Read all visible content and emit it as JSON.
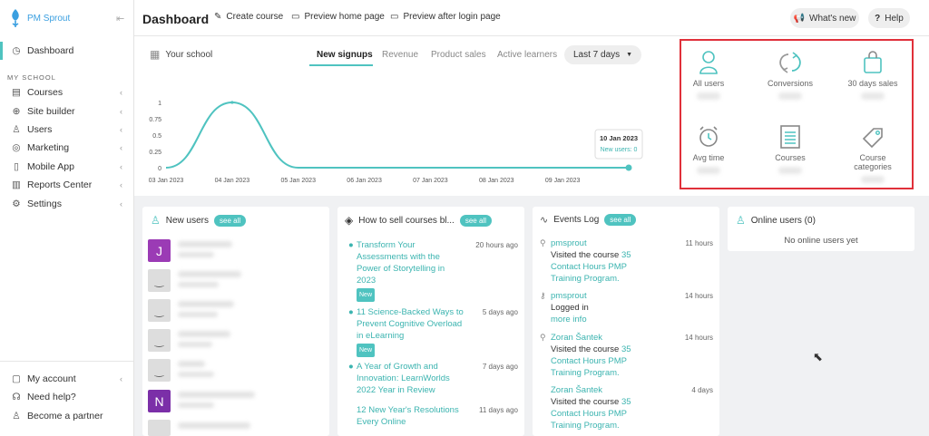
{
  "app": {
    "name": "PM Sprout"
  },
  "sidebar": {
    "dashboard": "Dashboard",
    "section_title": "MY SCHOOL",
    "items": [
      {
        "label": "Courses",
        "icon": "courses-icon"
      },
      {
        "label": "Site builder",
        "icon": "globe-icon"
      },
      {
        "label": "Users",
        "icon": "user-icon"
      },
      {
        "label": "Marketing",
        "icon": "marketing-icon"
      },
      {
        "label": "Mobile App",
        "icon": "mobile-icon"
      },
      {
        "label": "Reports Center",
        "icon": "reports-icon"
      },
      {
        "label": "Settings",
        "icon": "gear-icon"
      }
    ],
    "bottom": [
      {
        "label": "My account",
        "icon": "account-icon"
      },
      {
        "label": "Need help?",
        "icon": "headset-icon"
      },
      {
        "label": "Become a partner",
        "icon": "partner-icon"
      }
    ]
  },
  "header": {
    "title": "Dashboard",
    "links": [
      "Create course",
      "Preview home page",
      "Preview after login page"
    ],
    "whats_new": "What's new",
    "help": "Help"
  },
  "school": {
    "title": "Your school",
    "tabs": [
      "New signups",
      "Revenue",
      "Product sales",
      "Active learners"
    ],
    "active_tab": "New signups",
    "range": "Last 7 days"
  },
  "chart_data": {
    "type": "line",
    "x": [
      "03 Jan 2023",
      "04 Jan 2023",
      "05 Jan 2023",
      "06 Jan 2023",
      "07 Jan 2023",
      "08 Jan 2023",
      "09 Jan 2023",
      "10 Jan 2023"
    ],
    "series": [
      {
        "values": [
          0,
          1,
          0,
          0,
          0,
          0,
          0,
          0
        ]
      }
    ],
    "y_ticks": [
      "0",
      "0.25",
      "0.5",
      "0.75",
      "1"
    ],
    "ylim": [
      0,
      1
    ],
    "tooltip": {
      "date": "10 Jan 2023",
      "text": "New users: 0"
    },
    "color": "#4fc3c0"
  },
  "stats": [
    {
      "label": "All users",
      "icon": "user-outline-icon"
    },
    {
      "label": "Conversions",
      "icon": "conversions-icon"
    },
    {
      "label": "30 days sales",
      "icon": "shopping-bag-icon"
    },
    {
      "label": "Avg time",
      "icon": "alarm-clock-icon"
    },
    {
      "label": "Courses",
      "icon": "courses-list-icon"
    },
    {
      "label": "Course categories",
      "icon": "tag-icon"
    }
  ],
  "new_users": {
    "title": "New users",
    "see_all": "see all",
    "initials": [
      "J",
      "N"
    ]
  },
  "blog": {
    "title": "How to sell courses bl...",
    "see_all": "see all",
    "posts": [
      {
        "title": "Transform Your Assessments with the Power of Storytelling in 2023",
        "time": "20 hours ago",
        "badge": "New"
      },
      {
        "title": "11 Science-Backed Ways to Prevent Cognitive Overload in eLearning",
        "time": "5 days ago",
        "badge": "New"
      },
      {
        "title": "A Year of Growth and Innovation: LearnWorlds 2022 Year in Review",
        "time": "7 days ago",
        "badge": ""
      },
      {
        "title": "12 New Year's Resolutions Every Online",
        "time": "11 days ago",
        "badge": ""
      }
    ]
  },
  "events": {
    "title": "Events Log",
    "see_all": "see all",
    "items": [
      {
        "user": "pmsprout",
        "line1": "Visited the course",
        "link": "35 Contact Hours PMP Training Program.",
        "time": "11 hours"
      },
      {
        "user": "pmsprout",
        "line1": "Logged in",
        "link": "more info",
        "time": "14 hours"
      },
      {
        "user": "Zoran Šantek",
        "line1": "Visited the course",
        "link": "35 Contact Hours PMP Training Program.",
        "time": "14 hours"
      },
      {
        "user": "Zoran Šantek",
        "line1": "Visited the course",
        "link": "35 Contact Hours PMP Training Program.",
        "time": "4 days"
      }
    ]
  },
  "online": {
    "title": "Online users (0)",
    "empty": "No online users yet"
  }
}
